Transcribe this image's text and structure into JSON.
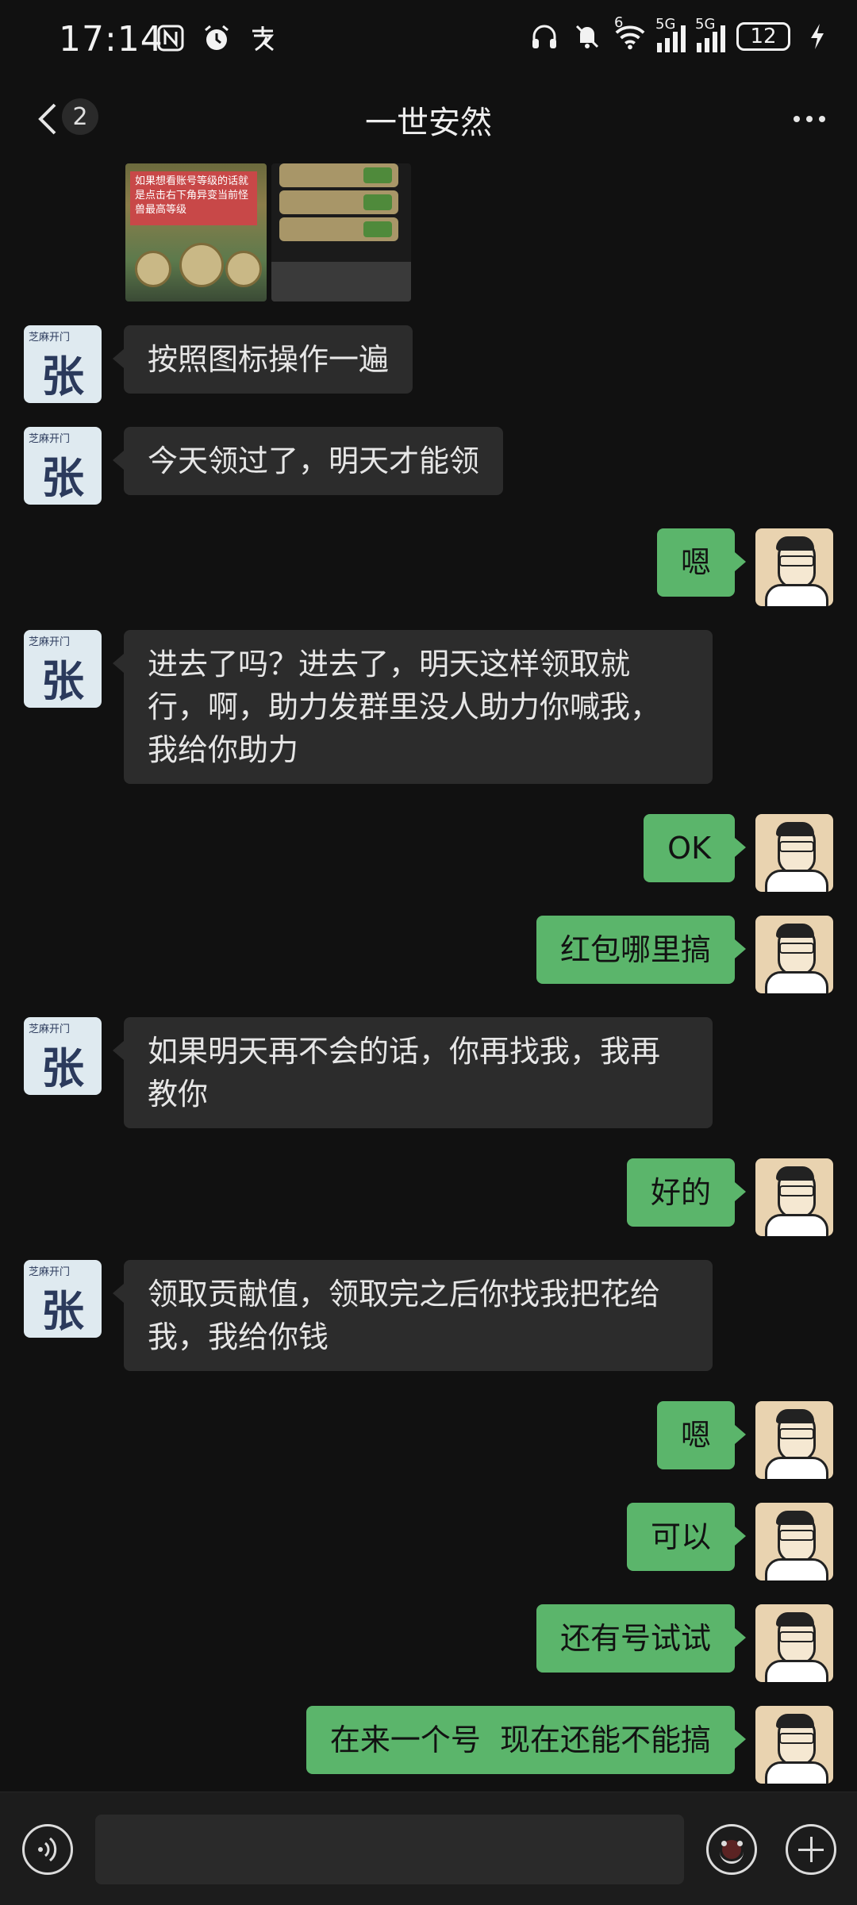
{
  "status_bar": {
    "time": "17:14",
    "battery": "12",
    "signal_1": "5G",
    "signal_2": "5G",
    "wifi_badge": "6"
  },
  "header": {
    "title": "一世安然",
    "unread_count": "2"
  },
  "image_preview": {
    "overlay_text": "如果想看账号等级的话就是点击右下角异变当前怪兽最高等级"
  },
  "messages": [
    {
      "side": "left",
      "text": "按照图标操作一遍"
    },
    {
      "side": "left",
      "text": "今天领过了，明天才能领"
    },
    {
      "side": "right",
      "text": "嗯"
    },
    {
      "side": "left",
      "text": "进去了吗？进去了，明天这样领取就行，啊，助力发群里没人助力你喊我，我给你助力"
    },
    {
      "side": "right",
      "text": "OK"
    },
    {
      "side": "right",
      "text": "红包哪里搞"
    },
    {
      "side": "left",
      "text": "如果明天再不会的话，你再找我，我再教你"
    },
    {
      "side": "right",
      "text": "好的"
    },
    {
      "side": "left",
      "text": "领取贡献值，领取完之后你找我把花给我，我给你钱"
    },
    {
      "side": "right",
      "text": "嗯"
    },
    {
      "side": "right",
      "text": "可以"
    },
    {
      "side": "right",
      "text": "还有号试试"
    },
    {
      "side": "right",
      "text": "在来一个号  现在还能不能搞"
    }
  ],
  "avatars": {
    "contact_text": "张",
    "contact_caption": "芝麻开门"
  },
  "input_bar": {
    "draft_text": ""
  },
  "icons": {
    "back": "chevron-left-icon",
    "more": "more-dots-icon",
    "voice": "voice-icon",
    "emoji": "emoji-icon",
    "plus": "plus-icon"
  },
  "colors": {
    "background": "#111111",
    "outgoing_bubble": "#5bb56b",
    "incoming_bubble": "#2c2c2c"
  }
}
